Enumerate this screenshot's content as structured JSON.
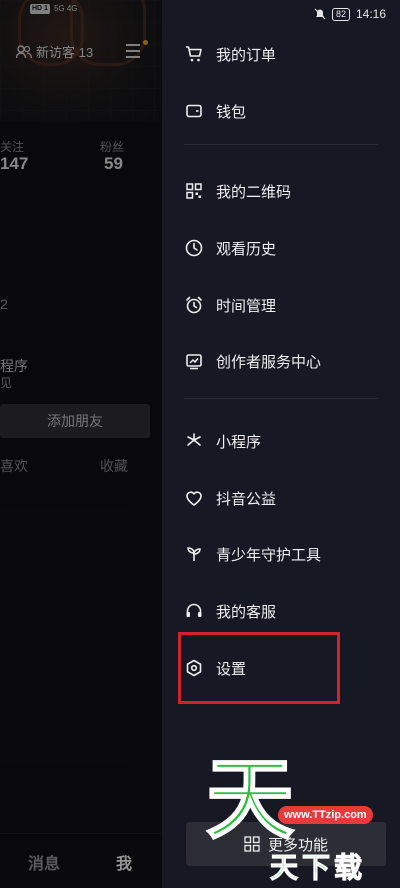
{
  "status_bar": {
    "left_badges": [
      "HD 1",
      "HD 2"
    ],
    "left_signal": "5G 4G",
    "battery": "82",
    "time": "14:16"
  },
  "profile": {
    "visitors_label": "新访客 13",
    "stats": [
      {
        "label": "关注",
        "value": "147"
      },
      {
        "label": "粉丝",
        "value": "59"
      }
    ],
    "fragment_2": "2",
    "fragment_mini": "程序",
    "fragment_mini_sub": "见",
    "add_friend": "添加朋友",
    "tabs": [
      "喜欢",
      "收藏"
    ],
    "bottom_nav": {
      "messages": "消息",
      "me": "我"
    }
  },
  "drawer": {
    "group1": [
      {
        "label": "我的订单",
        "icon": "cart-icon"
      },
      {
        "label": "钱包",
        "icon": "wallet-icon"
      }
    ],
    "group2": [
      {
        "label": "我的二维码",
        "icon": "qrcode-icon"
      },
      {
        "label": "观看历史",
        "icon": "history-icon"
      },
      {
        "label": "时间管理",
        "icon": "alarm-icon"
      },
      {
        "label": "创作者服务中心",
        "icon": "chart-icon"
      }
    ],
    "group3": [
      {
        "label": "小程序",
        "icon": "miniprogram-icon"
      },
      {
        "label": "抖音公益",
        "icon": "heart-icon"
      },
      {
        "label": "青少年守护工具",
        "icon": "sprout-icon"
      },
      {
        "label": "我的客服",
        "icon": "headset-icon"
      },
      {
        "label": "设置",
        "icon": "settings-icon"
      }
    ],
    "more_button": "更多功能",
    "highlight_color": "#d3202d"
  },
  "watermark": {
    "glyph": "天",
    "url": "www.TTzip.com",
    "text": "天下载"
  }
}
